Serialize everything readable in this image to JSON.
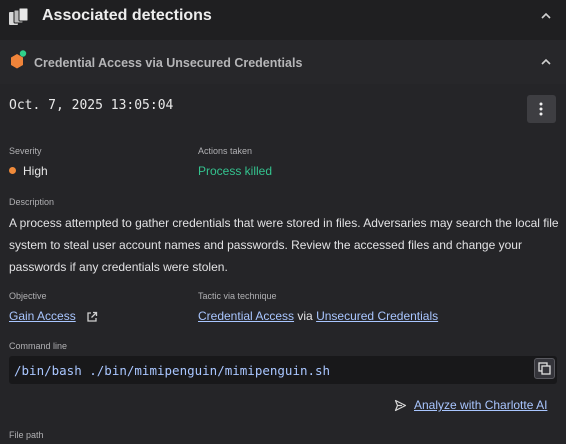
{
  "panel": {
    "title": "Associated detections"
  },
  "detection": {
    "title": "Credential Access via Unsecured Credentials",
    "timestamp": "Oct. 7, 2025 13:05:04",
    "severity_label": "Severity",
    "severity_value": "High",
    "actions_label": "Actions taken",
    "actions_value": "Process killed",
    "description_label": "Description",
    "description": "A process attempted to gather credentials that were stored in files. Adversaries may search the local file system to steal user account names and passwords. Review the accessed files and change your passwords if any credentials were stolen.",
    "objective_label": "Objective",
    "objective_value": "Gain Access",
    "tactic_label": "Tactic via technique",
    "tactic_value": "Credential Access",
    "tactic_via": "via",
    "technique_value": "Unsecured Credentials",
    "command_label": "Command line",
    "command_value": "/bin/bash ./bin/mimipenguin/mimipenguin.sh",
    "analyze_label": "Analyze with Charlotte AI",
    "file_path_label": "File path"
  },
  "colors": {
    "background": "#1f1f21",
    "accent_link": "#a9c6ff",
    "severity_high": "#f08a3a",
    "success": "#34c38f",
    "detection_icon": "#f0843a",
    "status_dot": "#2fd08a"
  },
  "icons": {
    "panel": "stacked-layers-icon",
    "detection": "hexagon-detection-icon",
    "collapse": "chevron-up-icon",
    "menu": "kebab-menu-icon",
    "external": "external-link-icon",
    "copy": "copy-icon",
    "analyze": "send-arrow-icon"
  }
}
